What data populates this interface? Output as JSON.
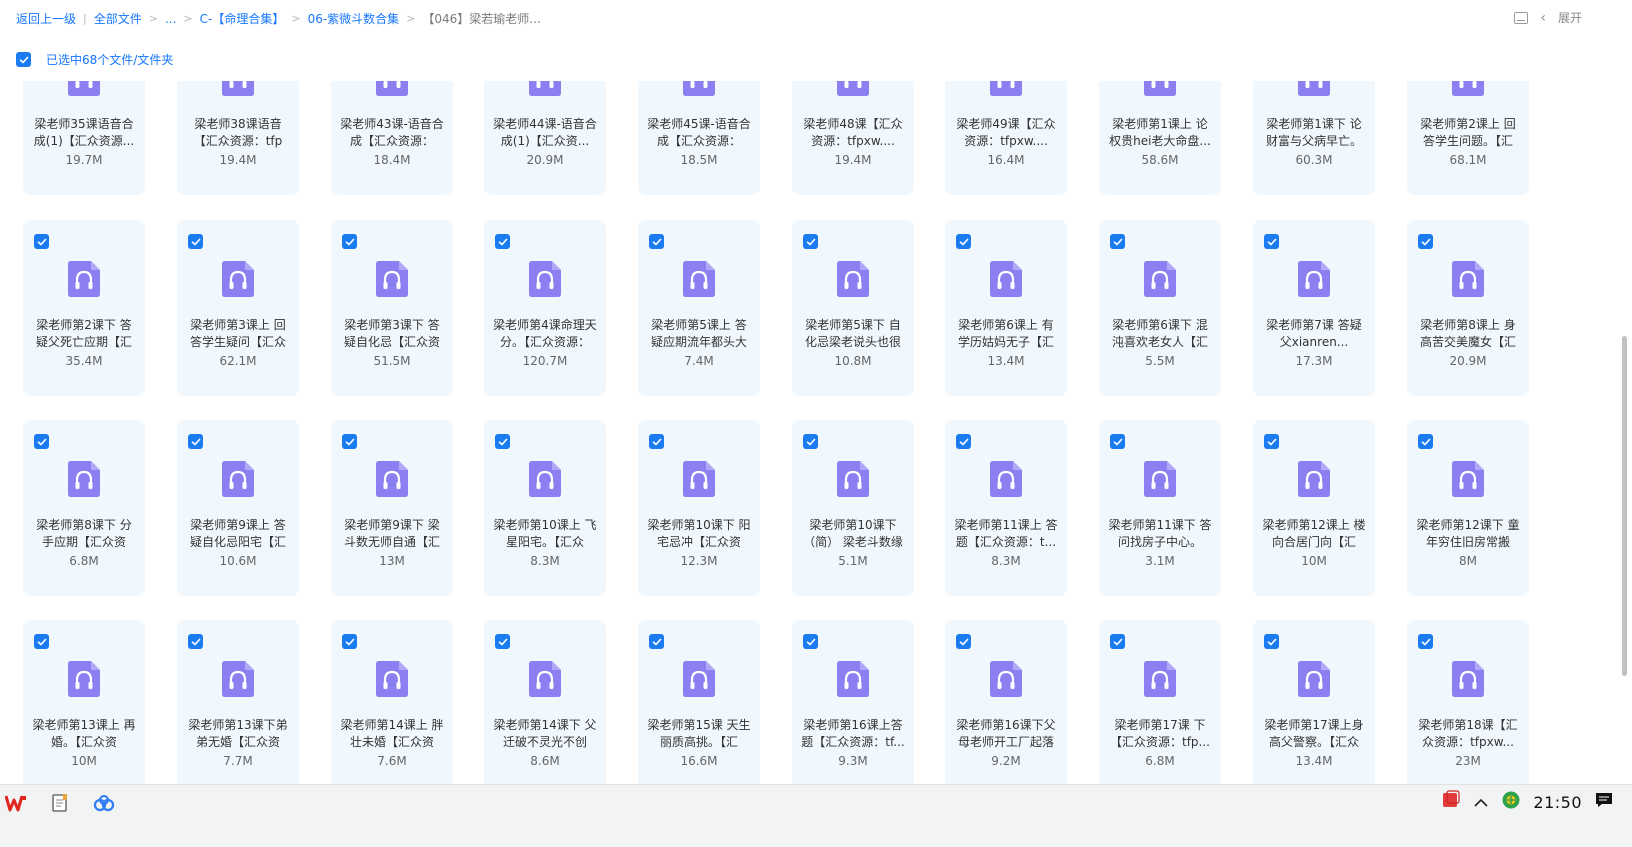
{
  "breadcrumb": {
    "back_label": "返回上一级",
    "items": [
      "全部文件",
      "...",
      "C-【命理合集】",
      "06-紫微斗数合集",
      "【046】梁若瑜老师..."
    ],
    "separator": ">",
    "separator_after_back": "|"
  },
  "header_right": {
    "expand_label": "展开"
  },
  "selection": {
    "label": "已选中68个文件/文件夹",
    "checked": true
  },
  "files": [
    {
      "name": "梁老师35课语音合成(1)【汇众资源...",
      "size": "19.7M",
      "checked": true
    },
    {
      "name": "梁老师38课语音【汇众资源：tfp",
      "size": "19.4M",
      "checked": true
    },
    {
      "name": "梁老师43课-语音合成【汇众资源：",
      "size": "18.4M",
      "checked": true
    },
    {
      "name": "梁老师44课-语音合成(1)【汇众资...",
      "size": "20.9M",
      "checked": true
    },
    {
      "name": "梁老师45课-语音合成【汇众资源：",
      "size": "18.5M",
      "checked": true
    },
    {
      "name": "梁老师48课【汇众资源：tfpxw....",
      "size": "19.4M",
      "checked": true
    },
    {
      "name": "梁老师49课【汇众资源：tfpxw....",
      "size": "16.4M",
      "checked": true
    },
    {
      "name": "梁老师第1课上 论权贵hei老大命盘...",
      "size": "58.6M",
      "checked": true
    },
    {
      "name": "梁老师第1课下 论财富与父病早亡。",
      "size": "60.3M",
      "checked": true
    },
    {
      "name": "梁老师第2课上 回答学生问题。【汇",
      "size": "68.1M",
      "checked": true
    },
    {
      "name": "梁老师第2课下 答疑父死亡应期【汇",
      "size": "35.4M",
      "checked": true
    },
    {
      "name": "梁老师第3课上 回答学生疑问【汇众",
      "size": "62.1M",
      "checked": true
    },
    {
      "name": "梁老师第3课下 答疑自化忌【汇众资",
      "size": "51.5M",
      "checked": true
    },
    {
      "name": "梁老师第4课命理天分。【汇众资源：",
      "size": "120.7M",
      "checked": true
    },
    {
      "name": "梁老师第5课上 答疑应期流年都头大",
      "size": "7.4M",
      "checked": true
    },
    {
      "name": "梁老师第5课下 自化忌梁老说头也很",
      "size": "10.8M",
      "checked": true
    },
    {
      "name": "梁老师第6课上 有学历姑妈无子【汇",
      "size": "13.4M",
      "checked": true
    },
    {
      "name": "梁老师第6课下 混沌喜欢老女人【汇",
      "size": "5.5M",
      "checked": true
    },
    {
      "name": "梁老师第7课 答疑父xianren...",
      "size": "17.3M",
      "checked": true
    },
    {
      "name": "梁老师第8课上 身高苦交美魔女【汇",
      "size": "20.9M",
      "checked": true
    },
    {
      "name": "梁老师第8课下 分手应期【汇众资",
      "size": "6.8M",
      "checked": true
    },
    {
      "name": "梁老师第9课上 答疑自化忌阳宅【汇",
      "size": "10.6M",
      "checked": true
    },
    {
      "name": "梁老师第9课下 梁斗数无师自通【汇",
      "size": "13M",
      "checked": true
    },
    {
      "name": "梁老师第10课上 飞星阳宅。【汇众",
      "size": "8.3M",
      "checked": true
    },
    {
      "name": "梁老师第10课下 阳宅忌冲【汇众资",
      "size": "12.3M",
      "checked": true
    },
    {
      "name": "梁老师第10课下（简） 梁老斗数缘",
      "size": "5.1M",
      "checked": true
    },
    {
      "name": "梁老师第11课上 答题【汇众资源：t...",
      "size": "8.3M",
      "checked": true
    },
    {
      "name": "梁老师第11课下 答问找房子中心。",
      "size": "3.1M",
      "checked": true
    },
    {
      "name": "梁老师第12课上 楼向合居门向【汇",
      "size": "10M",
      "checked": true
    },
    {
      "name": "梁老师第12课下 童年穷住旧房常搬",
      "size": "8M",
      "checked": true
    },
    {
      "name": "梁老师第13课上 再婚。【汇众资",
      "size": "10M",
      "checked": true
    },
    {
      "name": "梁老师第13课下弟弟无婚【汇众资",
      "size": "7.7M",
      "checked": true
    },
    {
      "name": "梁老师第14课上 胖壮未婚【汇众资",
      "size": "7.6M",
      "checked": true
    },
    {
      "name": "梁老师第14课下 父迁破不灵光不创",
      "size": "8.6M",
      "checked": true
    },
    {
      "name": "梁老师第15课 天生丽质高挑。【汇",
      "size": "16.6M",
      "checked": true
    },
    {
      "name": "梁老师第16课上答题【汇众资源：tf...",
      "size": "9.3M",
      "checked": true
    },
    {
      "name": "梁老师第16课下父母老师开工厂起落",
      "size": "9.2M",
      "checked": true
    },
    {
      "name": "梁老师第17课 下【汇众资源：tfp...",
      "size": "6.8M",
      "checked": true
    },
    {
      "name": "梁老师第17课上身高父警察。【汇众",
      "size": "13.4M",
      "checked": true
    },
    {
      "name": "梁老师第18课【汇众资源：tfpxw...",
      "size": "23M",
      "checked": true
    }
  ],
  "taskbar": {
    "apps": [
      "wps-icon",
      "notepad-icon",
      "baidu-netdisk-icon"
    ],
    "tray": [
      "chevron-up-icon",
      "antivirus-icon"
    ],
    "clock": "21:50"
  },
  "colors": {
    "accent": "#1a7cf0",
    "card_bg": "#f0f7fd",
    "audio_icon": "#8b7ff2"
  }
}
